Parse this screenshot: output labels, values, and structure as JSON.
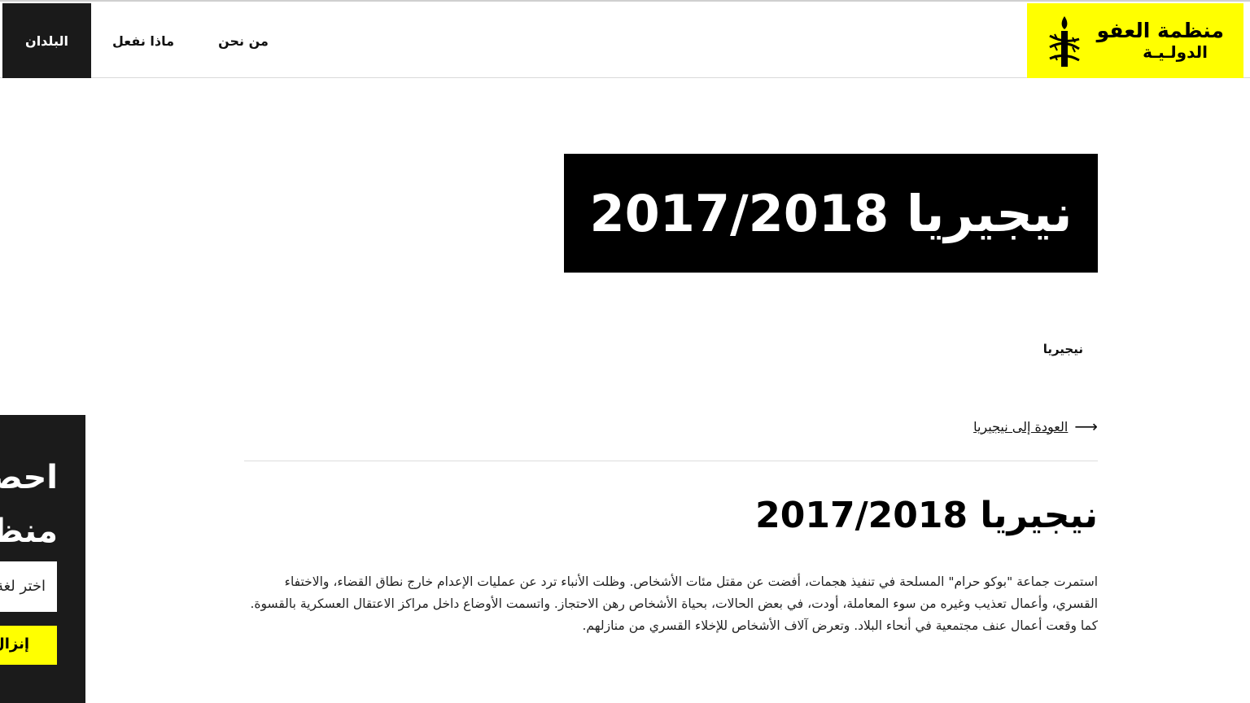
{
  "header": {
    "logo": {
      "line1": "منظمة العفو",
      "line2": "الدولـيـة",
      "icon": "candle-barbed-wire-icon",
      "bg_color": "#ffff00"
    },
    "nav": [
      {
        "label": "البلدان",
        "active": true
      },
      {
        "label": "ماذا نفعل",
        "active": false
      },
      {
        "label": "من نحن",
        "active": false
      }
    ]
  },
  "hero": {
    "title": "نيجيريا 2017/2018"
  },
  "breadcrumb": "نيجيريا",
  "back_link": {
    "label": "العودة إلى نيجيريا",
    "icon": "arrow-right-icon"
  },
  "article": {
    "title": "نيجيريا 2017/2018",
    "body": "استمرت جماعة \"بوكو حرام\" المسلحة في تنفيذ هجمات، أفضت عن مقتل مئات الأشخاص. وظلت الأنباء ترد عن عمليات الإعدام خارج نطاق القضاء، والاختفاء القسري، وأعمال تعذيب وغيره من سوء المعاملة، أودت، في بعض الحالات، بحياة الأشخاص رهن الاحتجاز. واتسمت الأوضاع داخل مراكز الاعتقال العسكرية بالقسوة. كما وقعت أعمال عنف مجتمعية في أنحاء البلاد. وتعرض آلاف الأشخاص للإخلاء القسري من منازلهم."
  },
  "side_promo": {
    "heading_line1": "احصل على تقرير",
    "heading_line2": "منظمة العفو",
    "select_placeholder": "اختر لغة",
    "button_label": "إنزال"
  }
}
